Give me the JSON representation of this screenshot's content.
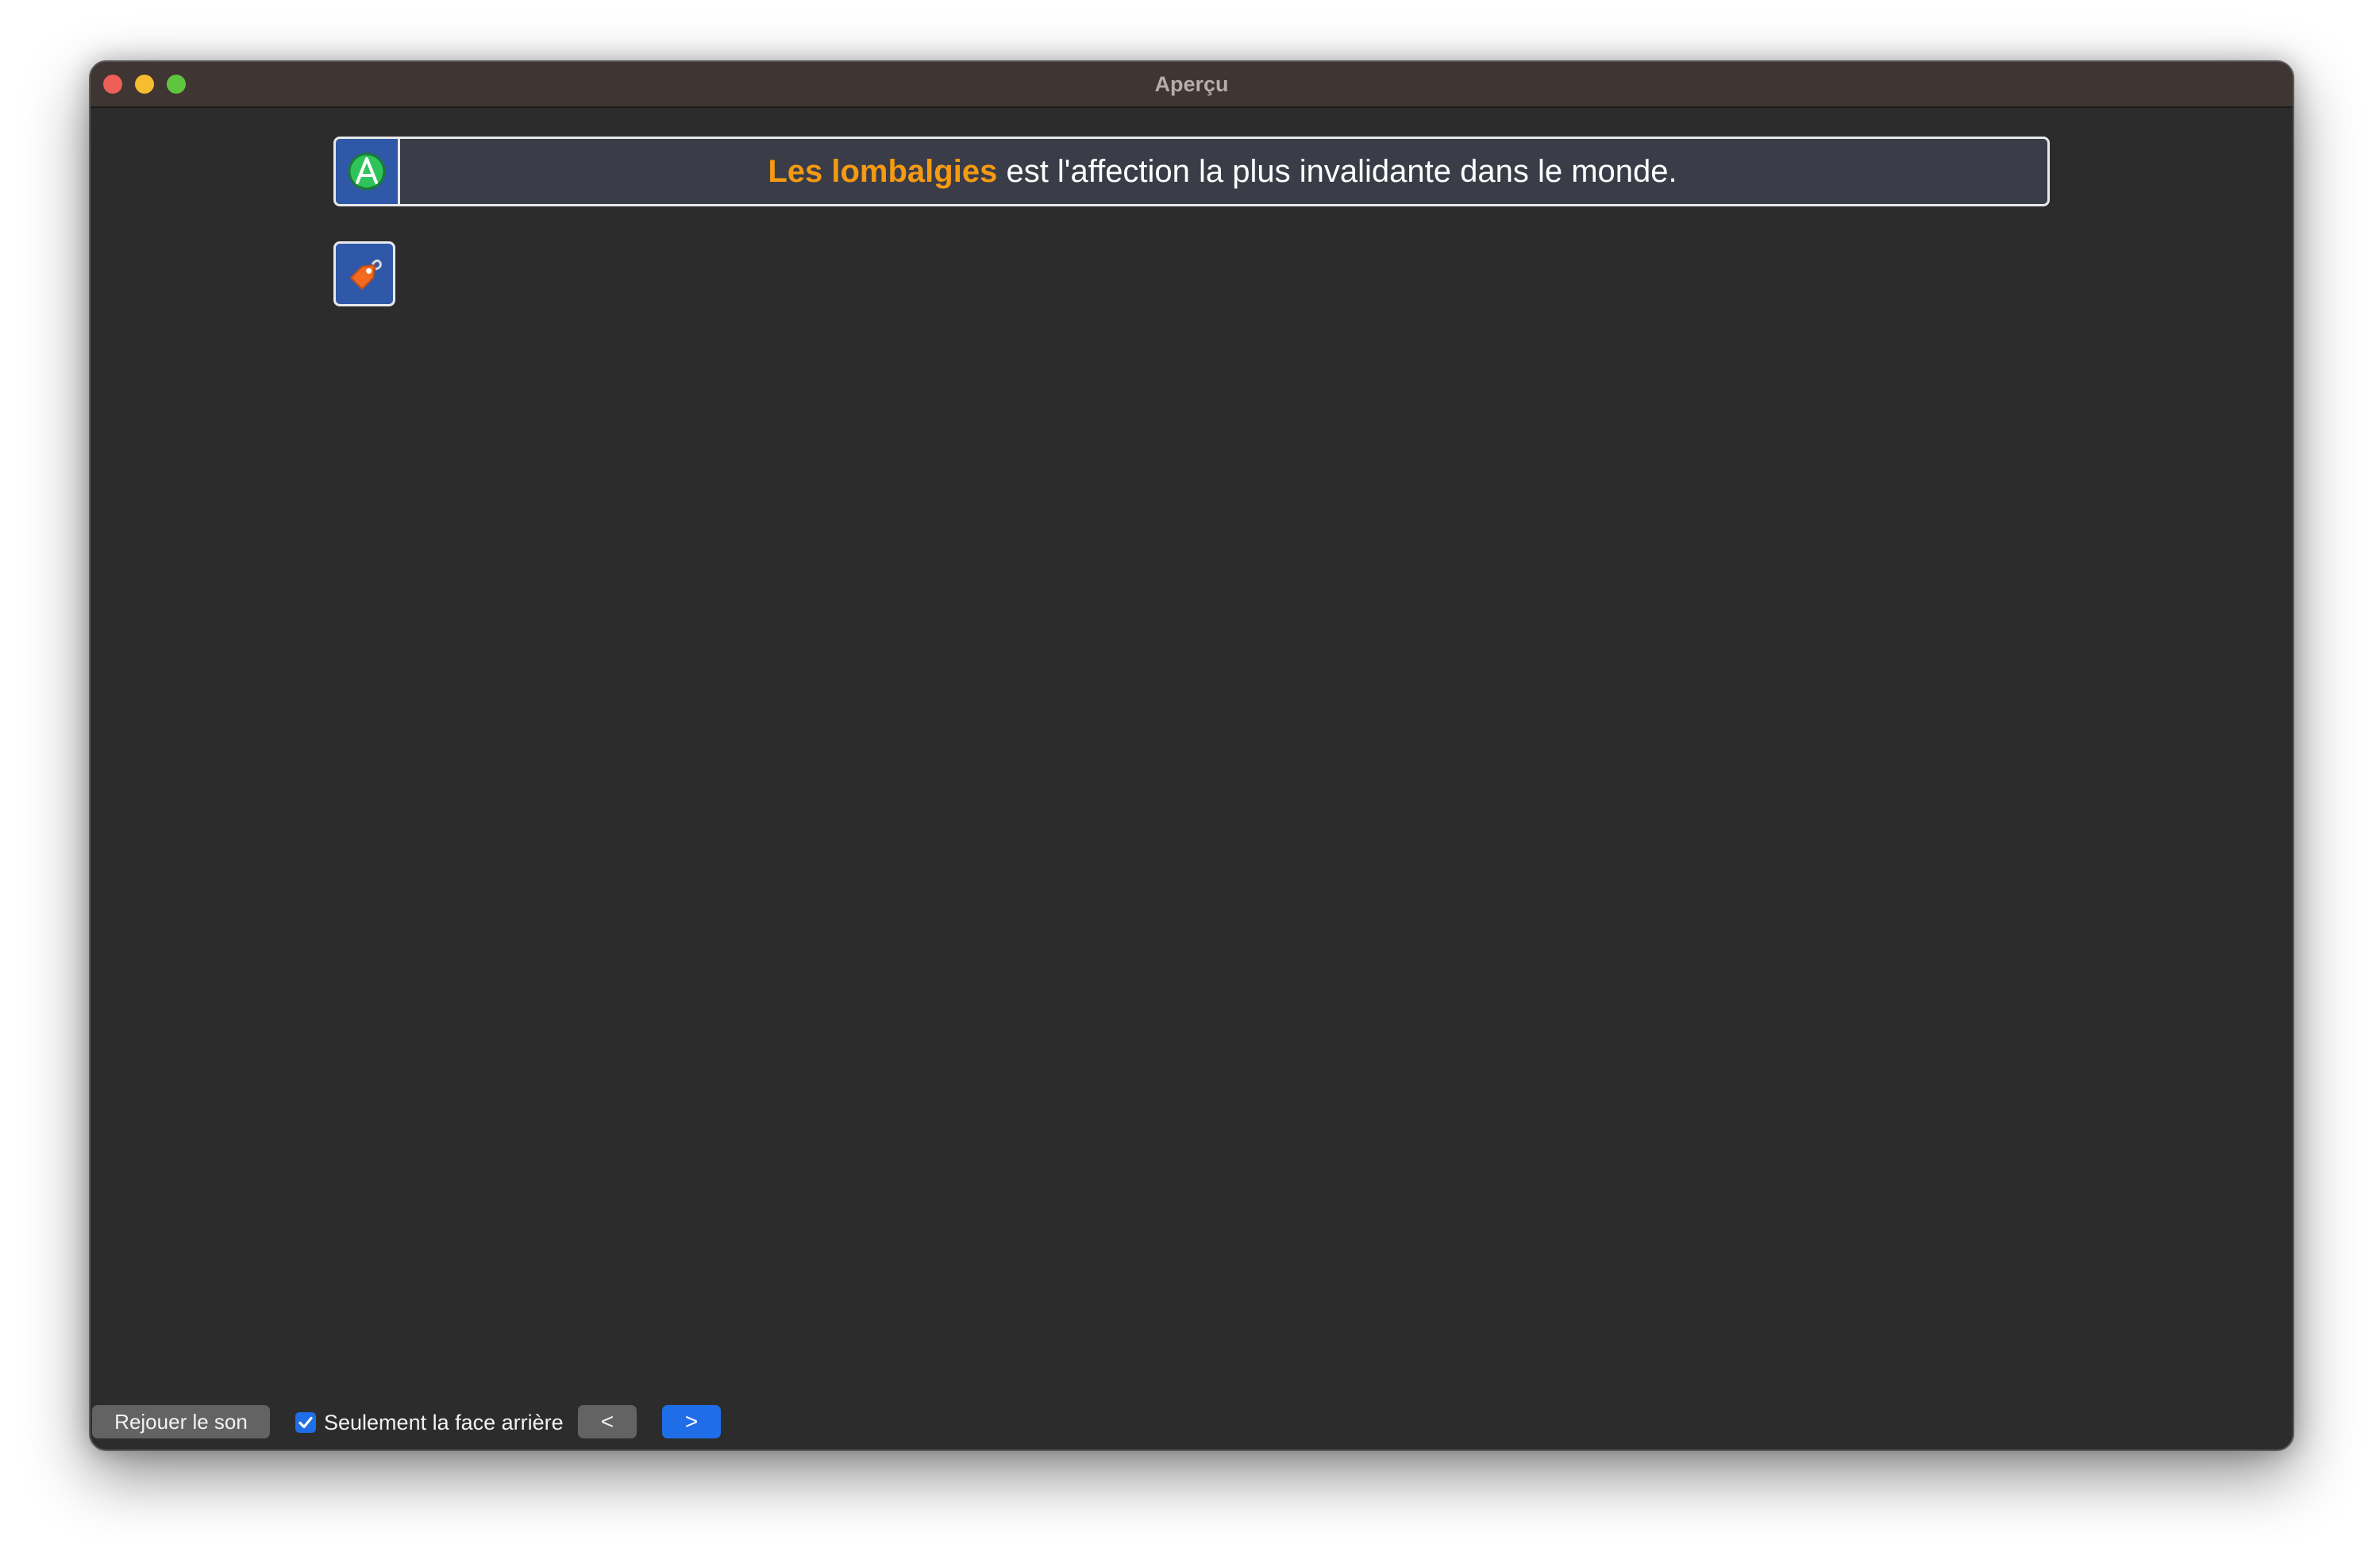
{
  "window": {
    "title": "Aperçu"
  },
  "card": {
    "highlight": "Les lombalgies",
    "text": " est l'affection la plus invalidante dans le monde.",
    "deck_icon": "anki-deck-icon",
    "tag_icon": "tag-icon"
  },
  "bottom": {
    "replay_label": "Rejouer le son",
    "checkbox_label": "Seulement la face arrière",
    "checkbox_checked": true,
    "prev_label": "<",
    "next_label": ">"
  },
  "colors": {
    "highlight": "#f59a12",
    "accent": "#1f6ee8",
    "icon_box": "#2f58a8",
    "background": "#2c2c2c"
  }
}
